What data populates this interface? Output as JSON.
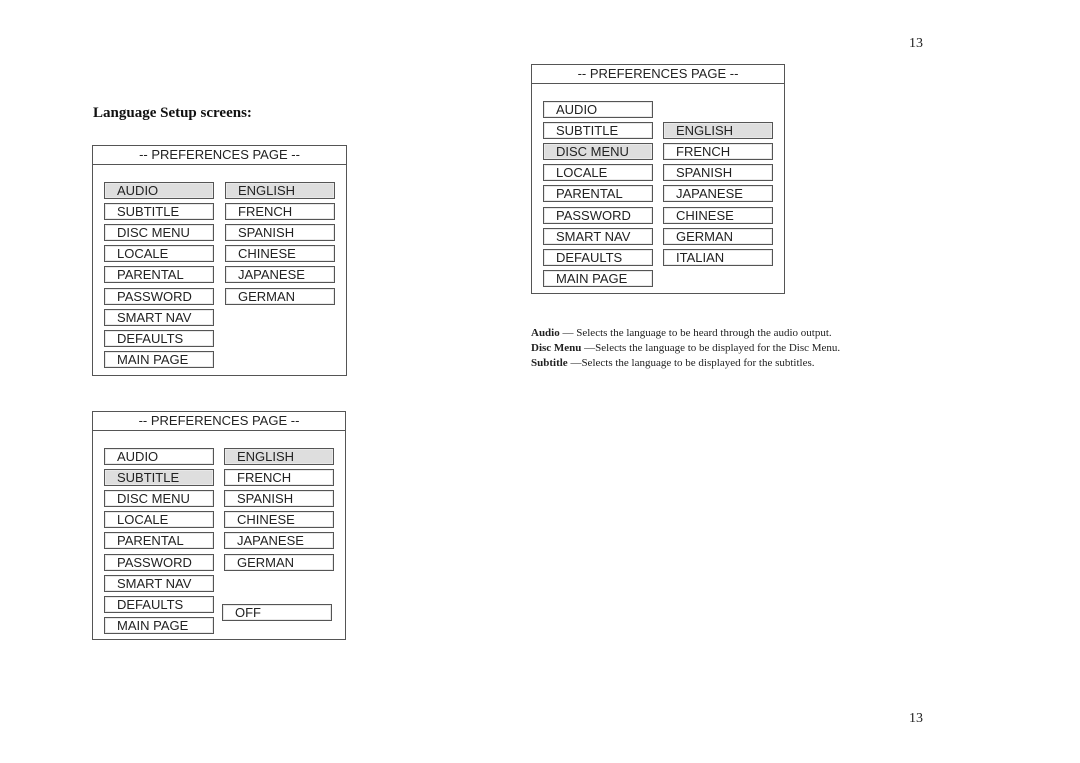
{
  "page_number_top": "13",
  "page_number_bottom": "13",
  "heading": "Language Setup screens:",
  "panels": [
    {
      "title": "-- PREFERENCES  PAGE --",
      "left_items": [
        "AUDIO",
        "SUBTITLE",
        "DISC MENU",
        "LOCALE",
        "PARENTAL",
        "PASSWORD",
        "SMART NAV",
        "DEFAULTS",
        "MAIN PAGE"
      ],
      "right_items": [
        "ENGLISH",
        "FRENCH",
        "SPANISH",
        "CHINESE",
        "JAPANESE",
        "GERMAN"
      ],
      "selected_left": "AUDIO",
      "selected_right": "ENGLISH"
    },
    {
      "title": "-- PREFERENCES  PAGE --",
      "left_items": [
        "AUDIO",
        "SUBTITLE",
        "DISC MENU",
        "LOCALE",
        "PARENTAL",
        "PASSWORD",
        "SMART NAV",
        "DEFAULTS",
        "MAIN PAGE"
      ],
      "right_items": [
        "ENGLISH",
        "FRENCH",
        "SPANISH",
        "CHINESE",
        "JAPANESE",
        "GERMAN",
        "OFF"
      ],
      "selected_left": "SUBTITLE",
      "selected_right": "ENGLISH"
    },
    {
      "title": "-- PREFERENCES  PAGE --",
      "left_items": [
        "AUDIO",
        "SUBTITLE",
        "DISC MENU",
        "LOCALE",
        "PARENTAL",
        "PASSWORD",
        "SMART NAV",
        "DEFAULTS",
        "MAIN PAGE"
      ],
      "right_items": [
        "ENGLISH",
        "FRENCH",
        "SPANISH",
        "JAPANESE",
        "CHINESE",
        "GERMAN",
        "ITALIAN"
      ],
      "selected_left": "DISC MENU",
      "selected_right": "ENGLISH"
    }
  ],
  "descriptions": [
    {
      "term": "Audio",
      "sep": " — ",
      "text": "Selects the language to be heard through the audio output."
    },
    {
      "term": "Disc Menu",
      "sep": " —",
      "text": "Selects the language to be displayed for the Disc Menu."
    },
    {
      "term": "Subtitle",
      "sep": " —",
      "text": "Selects the language to be displayed for the subtitles."
    }
  ]
}
